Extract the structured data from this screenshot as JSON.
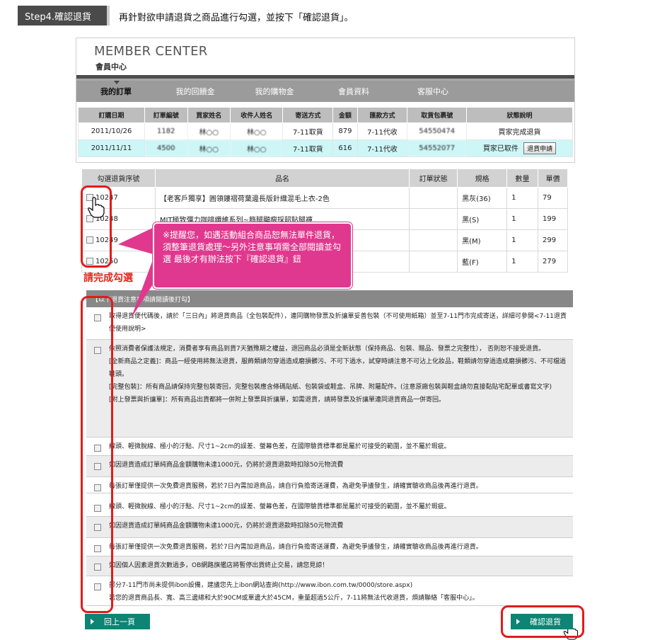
{
  "step": {
    "badge": "Step4.確認退貨",
    "instruction": "再針對欲申請退貨之商品進行勾選，並按下「確認退貨」。"
  },
  "member_center": {
    "title": "MEMBER CENTER",
    "subtitle": "會員中心",
    "nav": [
      "我的訂單",
      "我的回饋金",
      "我的購物金",
      "會員資料",
      "客服中心"
    ]
  },
  "orders": {
    "headers": [
      "訂購日期",
      "訂單編號",
      "買家姓名",
      "收件人姓名",
      "寄送方式",
      "金額",
      "匯款方式",
      "取貨包裹號",
      "狀態說明"
    ],
    "rows": [
      {
        "date": "2011/10/26",
        "no": "1182",
        "buyer": "林○○",
        "recipient": "林○○",
        "ship": "7-11取貨",
        "amount": "879",
        "pay": "7-11代收",
        "pkg": "54550474",
        "status": "買家完成退貨"
      },
      {
        "date": "2011/11/11",
        "no": "4500",
        "buyer": "林○○",
        "recipient": "林○○",
        "ship": "7-11取貨",
        "amount": "616",
        "pay": "7-11代收",
        "pkg": "54552077",
        "status": "買家已取件",
        "button": "退貨申請"
      }
    ]
  },
  "items": {
    "headers": [
      "勾選退貨序號",
      "品名",
      "訂單狀態",
      "規格",
      "數量",
      "單價"
    ],
    "rows": [
      {
        "id": "10247",
        "name": "【老客戶獨享】圓領鏤褶荷葉邊長版針織混毛上衣-2色",
        "status": "",
        "spec": "黑灰(36)",
        "qty": "1",
        "price": "79"
      },
      {
        "id": "10248",
        "name": "MIT極致彈力咖啡纖維系列~飾腿顯瘦採韶貼腿褲",
        "status": "",
        "spec": "黑(S)",
        "qty": "1",
        "price": "199"
      },
      {
        "id": "10249",
        "name": "",
        "status": "",
        "spec": "黑(M)",
        "qty": "1",
        "price": "299"
      },
      {
        "id": "10250",
        "name": "",
        "status": "",
        "spec": "藍(F)",
        "qty": "1",
        "price": "279"
      }
    ]
  },
  "callout": "※提醒您，如遇活動組合商品恕無法單件退貨，須整筆退貨處理～另外注意事項需全部閱讀並勾選 最後才有辦法按下『確認退貨』鈕",
  "please_check_label": "請完成勾選",
  "notice_header": "【以下退貨注意事項請閱讀後打勾】",
  "notices_top": [
    "取得退貨便代碼後，請於「三日內」將退貨商品（全包裝配件），連同購物發票及折讓單妥善包裝（不可使用紙箱）並至7-11門市完成寄送，詳細可參閱<7-11退貨便使用說明>",
    "依照消費者保護法規定，消費者享有商品到貨7天猶豫期之權益，退回商品必須是全新狀態（保持商品、包裝、贈品、發票之完整性）， 否則恕不接受退貨。\n[全新商品之定義]：商品一經使用將無法退貨，服飾類請勿穿過造成磨損髒污、不可下過水，試穿時請注意不可沾上化妝品，鞋類請勿穿過造成磨損髒污、不可檔過鞋頭。\n[完整包裝]：所有商品請保持完整包裝寄回，完整包裝應含條碼貼紙、包裝袋或鞋盒、吊牌、附屬配件。(注意原廠包裝與鞋盒請勿直接黏貼宅配單或書寫文字)\n[附上發票與折讓單]：所有商品出貨都將一併附上發票與折讓單，如需退貨，請將發票及折讓單連同退貨商品一併寄回。",
    "線頭、輕微脫線、極小的汙點、尺寸1~2cm的誤差、螢幕色差，在國際驗貨標準都是屬於可接受的範圍，並不屬於瑕疵。",
    "如因退貨造成訂單純商品金額購物未達1000元，仍將於退貨退款時扣除50元物流費",
    "每張訂單僅提供一次免費退貨服務，若於7日內需加退商品，請自行負擔寄送運費，為避免爭議發生，請確實驗收商品後再進行退貨。"
  ],
  "notices_bottom": [
    "線頭、輕微脫線、極小的汙點、尺寸1~2cm的誤差、螢幕色差，在國際驗貨標準都是屬於可接受的範圍，並不屬於瑕疵。",
    "如因退貨造成訂單純商品金額購物未達1000元，仍將於退貨退款時扣除50元物流費",
    "每張訂單僅提供一次免費退貨服務，若於7日內需加退商品，請自行負擔寄送運費，為避免爭議發生，請確實驗收商品後再進行退貨。",
    "如因個人因素退貨次數過多，OB網路旗艦店將暫停出貨終止交易，請您見諒！",
    "部分7-11門市尚未提供ibon設備，建議您先上ibon網站查詢(http://www.ibon.com.tw/0000/store.aspx)\n若您的退貨商品長、寬、高三邊總和大於90CM或單邊大於45CM，重量超過5公斤，7-11將無法代收退貨，煩請聯絡「客服中心」。"
  ],
  "buttons": {
    "prev": "回上一頁",
    "confirm": "確認退貨"
  },
  "colors": {
    "accent_green": "#0d8474",
    "annotation_red": "#e21b1b",
    "callout_pink": "#e0388e"
  }
}
